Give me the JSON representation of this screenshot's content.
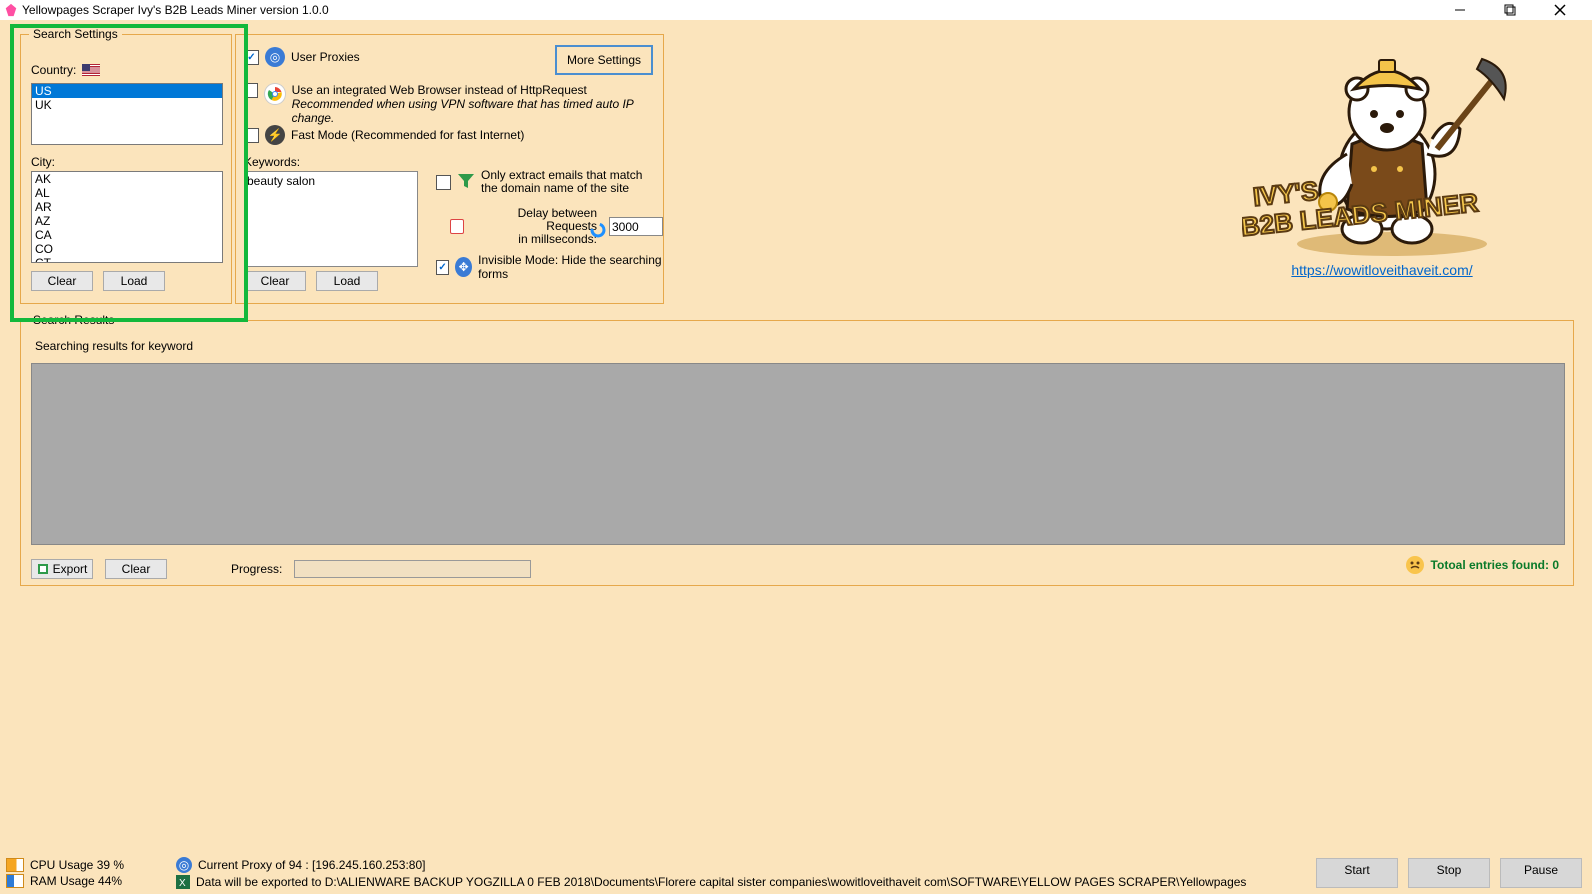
{
  "window": {
    "title": "Yellowpages Scraper Ivy's B2B Leads Miner version 1.0.0"
  },
  "search_settings": {
    "title": "Search Settings",
    "country_label": "Country:",
    "countries": [
      "US",
      "UK"
    ],
    "selected_country_index": 0,
    "city_label": "City:",
    "cities": [
      "AK",
      "AL",
      "AR",
      "AZ",
      "CA",
      "CO",
      "CT"
    ],
    "clear_btn": "Clear",
    "load_btn": "Load"
  },
  "options": {
    "user_proxies": {
      "checked": true,
      "label": "User Proxies"
    },
    "more_settings_btn": "More Settings",
    "integrated_browser": {
      "checked": false,
      "label": "Use an integrated Web Browser instead of HttpRequest",
      "hint": "Recommended when using VPN software that has timed auto IP change."
    },
    "fast_mode": {
      "checked": false,
      "label": "Fast Mode (Recommended for fast Internet)"
    },
    "keywords_label": "Keywords:",
    "keywords_value": "beauty salon",
    "keywords_clear": "Clear",
    "keywords_load": "Load",
    "only_match_domain": {
      "checked": false,
      "line1": "Only extract emails that match",
      "line2": "the domain name of the site"
    },
    "delay": {
      "line1": "Delay between Requests",
      "line2": "in millseconds:",
      "value": "3000"
    },
    "invisible": {
      "checked": true,
      "label": "Invisible Mode: Hide the searching forms"
    }
  },
  "branding": {
    "link_text": "https://wowitloveithaveit.com/",
    "product_line1": "IVY'S",
    "product_line2": "B2B LEADS MINER"
  },
  "results": {
    "title": "Search Results",
    "searching_label": "Searching results for keyword",
    "export_btn": "Export",
    "clear_btn": "Clear",
    "progress_label": "Progress:",
    "entries_label": "Totoal entries found: 0"
  },
  "status": {
    "cpu": "CPU Usage 39 %",
    "ram": "RAM Usage 44%",
    "proxy": "Current Proxy of 94 : [196.245.160.253:80]",
    "export_path": "Data will be exported to D:\\ALIENWARE BACKUP YOGZILLA 0 FEB 2018\\Documents\\Florere capital sister companies\\wowitloveithaveit com\\SOFTWARE\\YELLOW PAGES SCRAPER\\Yellowpages"
  },
  "run": {
    "start": "Start",
    "stop": "Stop",
    "pause": "Pause"
  }
}
